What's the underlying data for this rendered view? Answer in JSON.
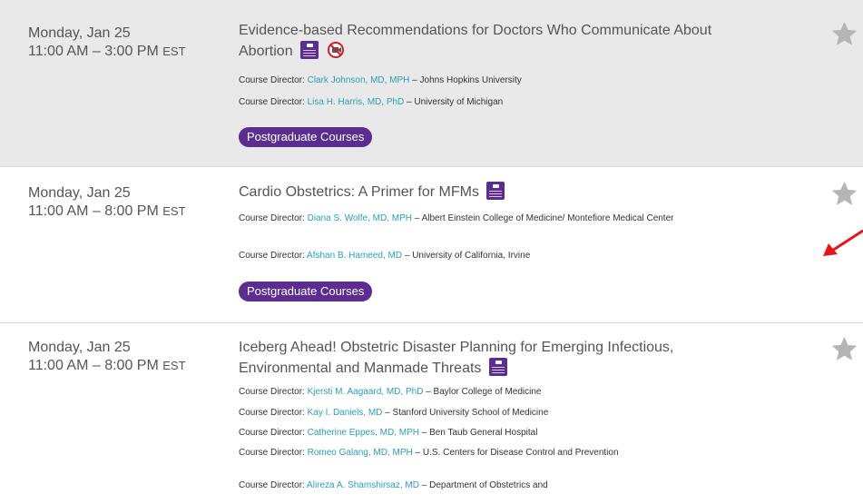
{
  "sessions": [
    {
      "date": "Monday, Jan 25",
      "time": "11:00 AM – 3:00 PM",
      "tz": "EST",
      "title": "Evidence-based Recommendations for Doctors Who Communicate About Abortion",
      "directors": [
        {
          "prefix": "Course Director:",
          "name": "Clark Johnson, MD, MPH",
          "affiliation": " – Johns Hopkins University"
        },
        {
          "prefix": "Course Director:",
          "name": "Lisa H. Harris, MD, PhD",
          "affiliation": " – University of Michigan"
        }
      ],
      "category": "Postgraduate Courses",
      "icons": [
        "registration-badge-icon",
        "no-recording-icon",
        "favorite-star-icon"
      ]
    },
    {
      "date": "Monday, Jan 25",
      "time": "11:00 AM – 8:00 PM",
      "tz": "EST",
      "title": "Cardio Obstetrics: A Primer for MFMs",
      "directors": [
        {
          "prefix": "Course Director:",
          "name": "Diana S. Wolfe, MD, MPH",
          "affiliation": " – Albert Einstein College of Medicine/ Montefiore Medical Center"
        },
        {
          "prefix": "Course Director:",
          "name": "Afshan B. Hameed, MD",
          "affiliation": " – University of California, Irvine"
        }
      ],
      "category": "Postgraduate Courses",
      "icons": [
        "registration-badge-icon",
        "favorite-star-icon"
      ]
    },
    {
      "date": "Monday, Jan 25",
      "time": "11:00 AM – 8:00 PM",
      "tz": "EST",
      "title": "Iceberg Ahead! Obstetric Disaster Planning for Emerging Infectious, Environmental and Manmade Threats",
      "directors": [
        {
          "prefix": "Course Director:",
          "name": "Kjersti M. Aagaard, MD, PhD",
          "affiliation": " – Baylor College of Medicine"
        },
        {
          "prefix": "Course Director:",
          "name": "Kay I. Daniels, MD",
          "affiliation": " – Stanford University School of Medicine"
        },
        {
          "prefix": "Course Director:",
          "name": "Catherine Eppes, MD, MPH",
          "affiliation": " – Ben Taub General Hospital"
        },
        {
          "prefix": "Course Director:",
          "name": "Romeo Galang, MD, MPH",
          "affiliation": " – U.S. Centers for Disease Control and Prevention"
        },
        {
          "prefix": "Course Director:",
          "name": "Alireza A. Shamshirsaz, MD",
          "affiliation": " – Department of Obstetrics and"
        }
      ],
      "icons": [
        "registration-badge-icon",
        "favorite-star-icon"
      ]
    }
  ],
  "colors": {
    "pill": "#5c2d91",
    "link": "#2aa0b8",
    "highlight_row": "#e9e9e9",
    "star": "#b5b5b5",
    "annotation_arrow": "#e8141b"
  },
  "annotation": "red-arrow-icon"
}
